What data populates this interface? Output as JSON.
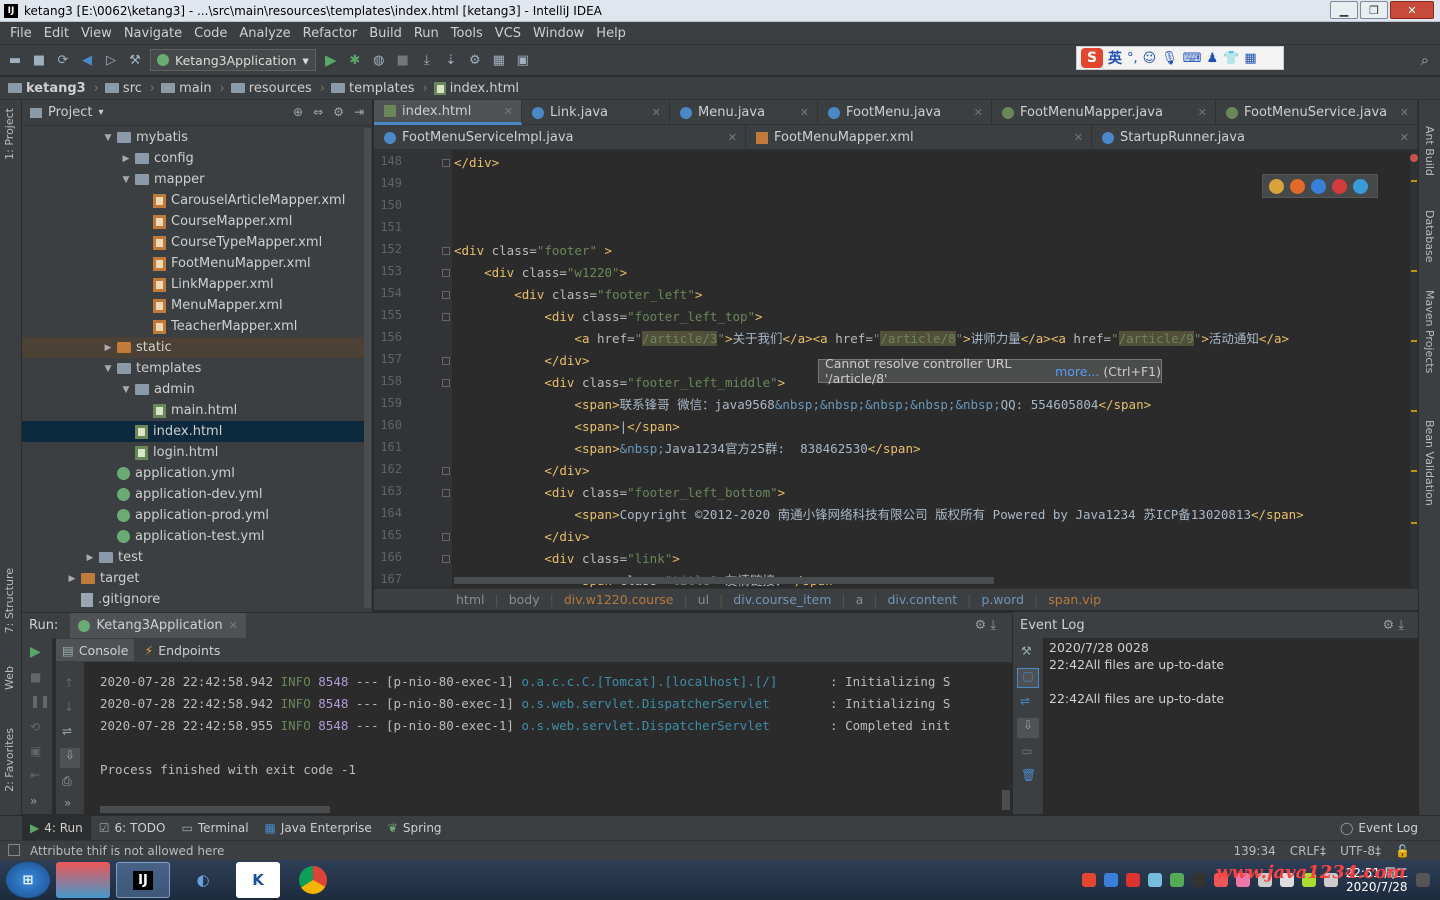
{
  "window": {
    "title": "ketang3 [E:\\0062\\ketang3] - ...\\src\\main\\resources\\templates\\index.html [ketang3] - IntelliJ IDEA",
    "app_icon": "IJ"
  },
  "menu": [
    "File",
    "Edit",
    "View",
    "Navigate",
    "Code",
    "Analyze",
    "Refactor",
    "Build",
    "Run",
    "Tools",
    "VCS",
    "Window",
    "Help"
  ],
  "toolbar": {
    "run_config": "Ketang3Application"
  },
  "ime": {
    "brand": "S",
    "lang": "英"
  },
  "breadcrumb": [
    "ketang3",
    "src",
    "main",
    "resources",
    "templates",
    "index.html"
  ],
  "side_tabs": {
    "left": [
      "1: Project",
      "7: Structure",
      "Web",
      "2: Favorites"
    ],
    "right": [
      "Ant Build",
      "Database",
      "Maven Projects",
      "Bean Validation"
    ]
  },
  "project": {
    "title": "Project",
    "rows": [
      {
        "label": "mybatis",
        "type": "folder",
        "indent": 0,
        "arrow": "▼"
      },
      {
        "label": "config",
        "type": "folder",
        "indent": 1,
        "arrow": "▶"
      },
      {
        "label": "mapper",
        "type": "folder",
        "indent": 1,
        "arrow": "▼"
      },
      {
        "label": "CarouselArticleMapper.xml",
        "type": "xml",
        "indent": 2,
        "arrow": ""
      },
      {
        "label": "CourseMapper.xml",
        "type": "xml",
        "indent": 2,
        "arrow": ""
      },
      {
        "label": "CourseTypeMapper.xml",
        "type": "xml",
        "indent": 2,
        "arrow": ""
      },
      {
        "label": "FootMenuMapper.xml",
        "type": "xml",
        "indent": 2,
        "arrow": ""
      },
      {
        "label": "LinkMapper.xml",
        "type": "xml",
        "indent": 2,
        "arrow": ""
      },
      {
        "label": "MenuMapper.xml",
        "type": "xml",
        "indent": 2,
        "arrow": ""
      },
      {
        "label": "TeacherMapper.xml",
        "type": "xml",
        "indent": 2,
        "arrow": ""
      },
      {
        "label": "static",
        "type": "folder-orange",
        "indent": 0,
        "arrow": "▶",
        "state": "static"
      },
      {
        "label": "templates",
        "type": "folder",
        "indent": 0,
        "arrow": "▼"
      },
      {
        "label": "admin",
        "type": "folder",
        "indent": 1,
        "arrow": "▼"
      },
      {
        "label": "main.html",
        "type": "html",
        "indent": 2,
        "arrow": ""
      },
      {
        "label": "index.html",
        "type": "html",
        "indent": 1,
        "arrow": "",
        "state": "selected"
      },
      {
        "label": "login.html",
        "type": "html",
        "indent": 1,
        "arrow": ""
      },
      {
        "label": "application.yml",
        "type": "yml",
        "indent": 0,
        "arrow": ""
      },
      {
        "label": "application-dev.yml",
        "type": "yml",
        "indent": 0,
        "arrow": ""
      },
      {
        "label": "application-prod.yml",
        "type": "yml",
        "indent": 0,
        "arrow": ""
      },
      {
        "label": "application-test.yml",
        "type": "yml",
        "indent": 0,
        "arrow": ""
      },
      {
        "label": "test",
        "type": "folder",
        "indent": -1,
        "arrow": "▶"
      },
      {
        "label": "target",
        "type": "folder-orange",
        "indent": -2,
        "arrow": "▶"
      },
      {
        "label": ".gitignore",
        "type": "file",
        "indent": -2,
        "arrow": ""
      }
    ]
  },
  "editor_tabs_row1": [
    {
      "label": "index.html",
      "icon": "html",
      "active": true
    },
    {
      "label": "Link.java",
      "icon": "java"
    },
    {
      "label": "Menu.java",
      "icon": "java"
    },
    {
      "label": "FootMenu.java",
      "icon": "java"
    },
    {
      "label": "FootMenuMapper.java",
      "icon": "iface"
    },
    {
      "label": "FootMenuService.java",
      "icon": "iface"
    }
  ],
  "editor_tabs_row2": [
    {
      "label": "FootMenuServiceImpl.java",
      "icon": "java"
    },
    {
      "label": "FootMenuMapper.xml",
      "icon": "xml"
    },
    {
      "label": "StartupRunner.java",
      "icon": "java"
    }
  ],
  "code": {
    "line_numbers": [
      "148",
      "149",
      "150",
      "151",
      "152",
      "153",
      "154",
      "155",
      "156",
      "157",
      "158",
      "159",
      "160",
      "161",
      "162",
      "163",
      "164",
      "165",
      "166",
      "167"
    ],
    "lines": [
      "</div>",
      "",
      "",
      "",
      "<div class=\"footer\" >",
      "    <div class=\"w1220\">",
      "        <div class=\"footer_left\">",
      "            <div class=\"footer_left_top\">",
      "                <a href=\"/article/3\">关于我们</a><a href=\"/article/8\">讲师力量</a><a href=\"/article/9\">活动通知</a>",
      "            </div>",
      "            <div class=\"footer_left_middle\">",
      "                <span>联系锋哥 微信：java9568&nbsp;&nbsp;&nbsp;&nbsp;&nbsp;QQ: 554605804</span>",
      "                <span>|</span>",
      "                <span>&nbsp;Java1234官方25群:  838462530</span>",
      "            </div>",
      "            <div class=\"footer_left_bottom\">",
      "                <span>Copyright ©2012-2020 南通小锋网络科技有限公司 版权所有 Powered by Java1234 苏ICP备13020813</span>",
      "            </div>",
      "            <div class=\"link\">",
      "                <span class=\"title\">友情链接：</span>"
    ]
  },
  "tooltip": {
    "text": "Cannot resolve controller URL '/article/8'",
    "more": "more...",
    "shortcut": "(Ctrl+F1)"
  },
  "editor_crumbs": [
    "html",
    "body",
    "div.w1220.course",
    "ul",
    "div.course_item",
    "a",
    "div.content",
    "p.word",
    "span.vip"
  ],
  "run": {
    "label": "Run:",
    "tab": "Ketang3Application",
    "subtabs": [
      "Console",
      "Endpoints"
    ],
    "lines": [
      {
        "date": "2020-07-28 22:42:58.942",
        "level": "INFO",
        "pid": "8548",
        "sep": "---",
        "thread": "[p-nio-80-exec-1]",
        "logger": "o.a.c.c.C.[Tomcat].[localhost].[/]      ",
        "msg": ": Initializing S"
      },
      {
        "date": "2020-07-28 22:42:58.942",
        "level": "INFO",
        "pid": "8548",
        "sep": "---",
        "thread": "[p-nio-80-exec-1]",
        "logger": "o.s.web.servlet.DispatcherServlet       ",
        "msg": ": Initializing S"
      },
      {
        "date": "2020-07-28 22:42:58.955",
        "level": "INFO",
        "pid": "8548",
        "sep": "---",
        "thread": "[p-nio-80-exec-1]",
        "logger": "o.s.web.servlet.DispatcherServlet       ",
        "msg": ": Completed init"
      }
    ],
    "exit": "Process finished with exit code -1"
  },
  "event_log": {
    "title": "Event Log",
    "entries": [
      {
        "line": "2020/7/28 0028"
      },
      {
        "line": "22:42All files are up-to-date"
      },
      {
        "line": "22:42All files are up-to-date"
      }
    ]
  },
  "bottom_tabs": [
    "4: Run",
    "6: TODO",
    "Terminal",
    "Java Enterprise",
    "Spring"
  ],
  "bottom_right": "Event Log",
  "status": {
    "message": "Attribute thif is not allowed here",
    "position": "139:34",
    "line_sep": "CRLF‡",
    "encoding": "UTF-8‡"
  },
  "taskbar": {
    "clock_time": "22:51 周二",
    "clock_date": "2020/7/28",
    "watermark": "www.java1234.com"
  },
  "colors": {
    "accent": "#4a88c7",
    "selection": "#0d293e",
    "string": "#6a8759",
    "tag": "#e8bf6a"
  }
}
